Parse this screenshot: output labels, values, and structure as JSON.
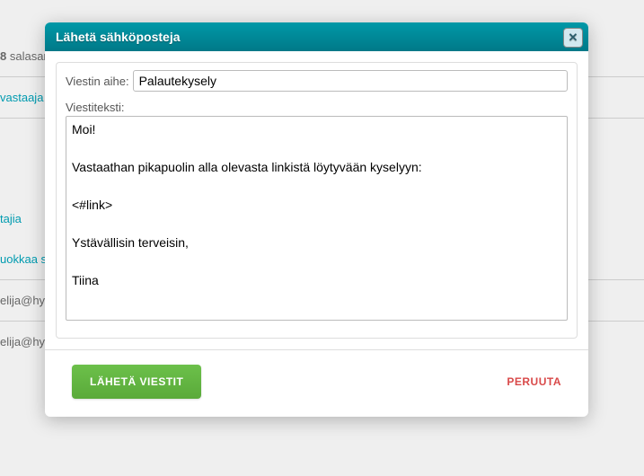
{
  "background": {
    "line1_bold": "8",
    "line1_rest": " salasar",
    "link1": "vastaaja",
    "link2": "tajia",
    "link3": "uokkaa s",
    "email_partial1": "elija@hy",
    "email_partial2": "elija@hy"
  },
  "dialog": {
    "title": "Lähetä sähköposteja",
    "close_icon": "✕",
    "subject_label": "Viestin aihe:",
    "subject_value": "Palautekysely",
    "body_label": "Viestiteksti:",
    "body_value": "Moi!\n\nVastaathan pikapuolin alla olevasta linkistä löytyvään kyselyyn:\n\n<#link>\n\nYstävällisin terveisin,\n\nTiina",
    "send_label": "LÄHETÄ VIESTIT",
    "cancel_label": "PERUUTA"
  }
}
